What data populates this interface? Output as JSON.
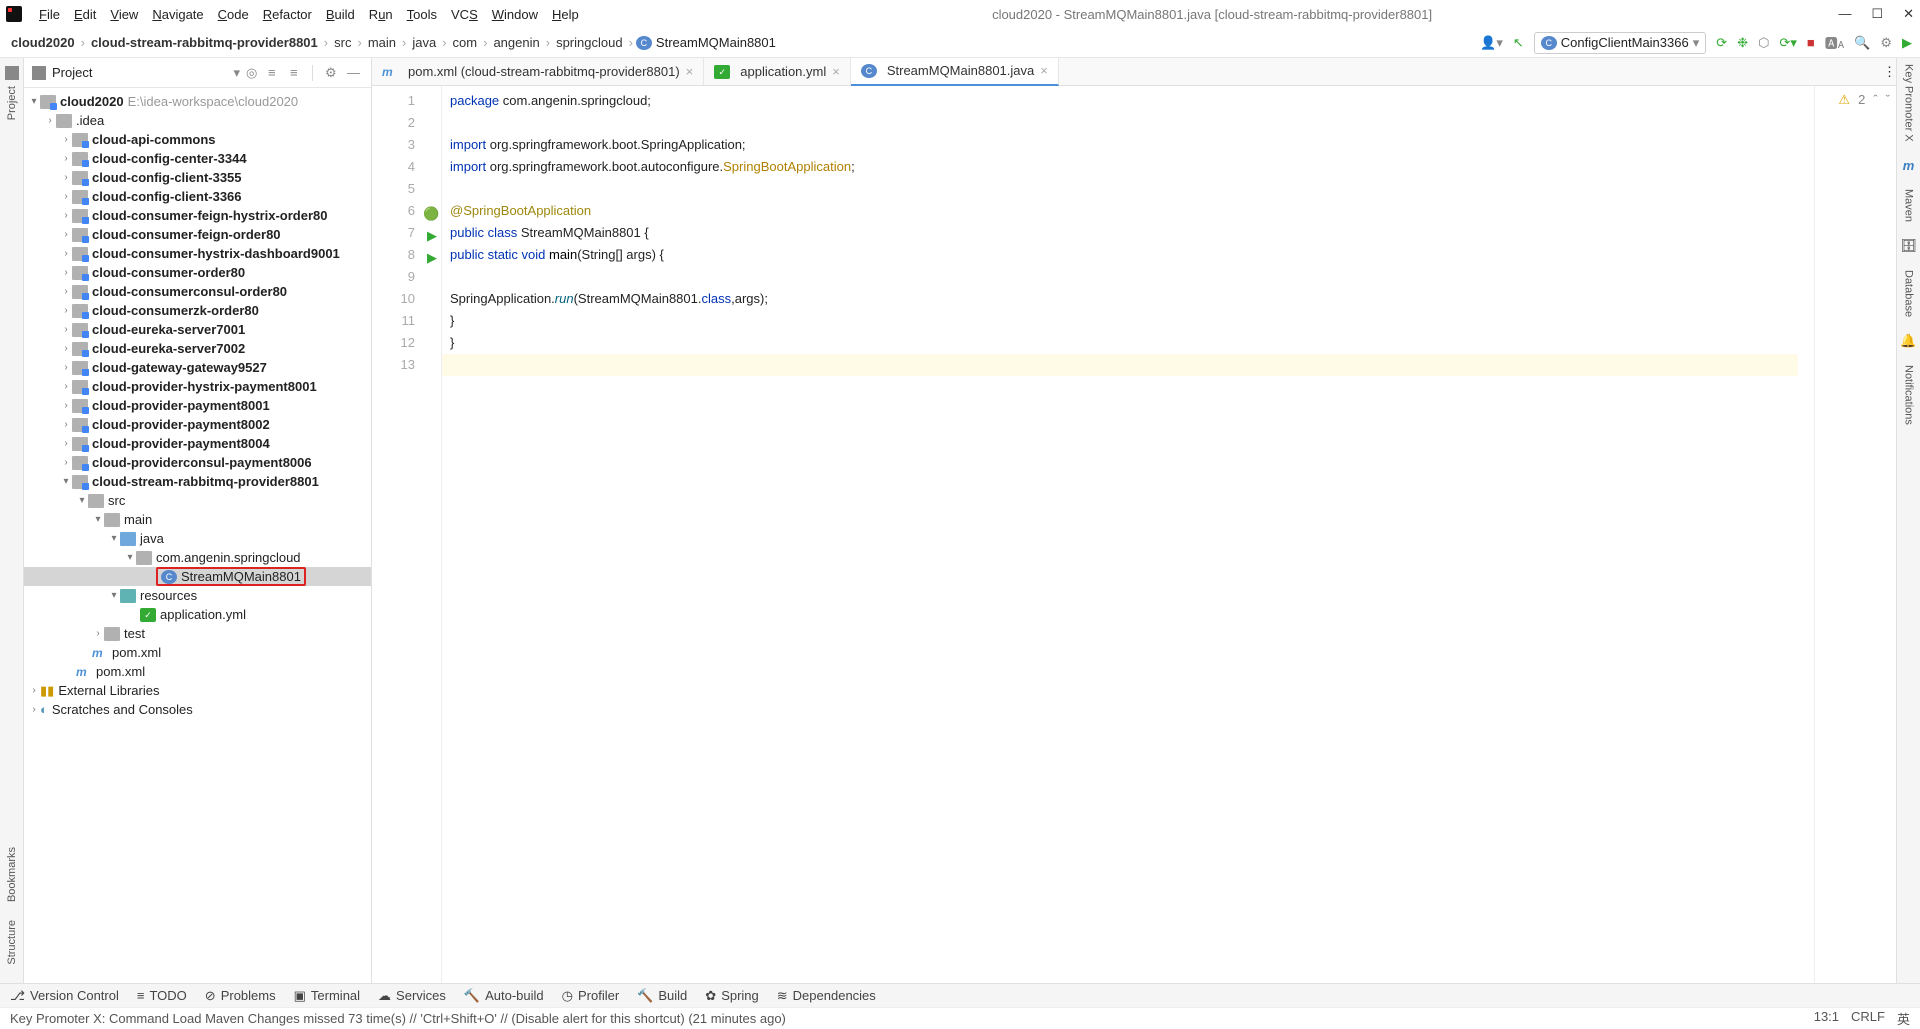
{
  "menu": [
    "File",
    "Edit",
    "View",
    "Navigate",
    "Code",
    "Refactor",
    "Build",
    "Run",
    "Tools",
    "VCS",
    "Window",
    "Help"
  ],
  "window_title": "cloud2020 - StreamMQMain8801.java [cloud-stream-rabbitmq-provider8801]",
  "breadcrumbs": [
    "cloud2020",
    "cloud-stream-rabbitmq-provider8801",
    "src",
    "main",
    "java",
    "com",
    "angenin",
    "springcloud"
  ],
  "breadcrumb_last": "StreamMQMain8801",
  "run_config": "ConfigClientMain3366",
  "panel_title": "Project",
  "root_name": "cloud2020",
  "root_path": "E:\\idea-workspace\\cloud2020",
  "tree": {
    "idea": ".idea",
    "modules": [
      "cloud-api-commons",
      "cloud-config-center-3344",
      "cloud-config-client-3355",
      "cloud-config-client-3366",
      "cloud-consumer-feign-hystrix-order80",
      "cloud-consumer-feign-order80",
      "cloud-consumer-hystrix-dashboard9001",
      "cloud-consumer-order80",
      "cloud-consumerconsul-order80",
      "cloud-consumerzk-order80",
      "cloud-eureka-server7001",
      "cloud-eureka-server7002",
      "cloud-gateway-gateway9527",
      "cloud-provider-hystrix-payment8001",
      "cloud-provider-payment8001",
      "cloud-provider-payment8002",
      "cloud-provider-payment8004",
      "cloud-providerconsul-payment8006",
      "cloud-stream-rabbitmq-provider8801"
    ],
    "src": "src",
    "main": "main",
    "java": "java",
    "pkg": "com.angenin.springcloud",
    "cls": "StreamMQMain8801",
    "resources": "resources",
    "yml": "application.yml",
    "test": "test",
    "pom": "pom.xml",
    "ext": "External Libraries",
    "scratches": "Scratches and Consoles"
  },
  "tabs": {
    "t1": "pom.xml (cloud-stream-rabbitmq-provider8801)",
    "t2": "application.yml",
    "t3": "StreamMQMain8801.java"
  },
  "code": {
    "l1a": "package",
    "l1b": " com.angenin.springcloud;",
    "l3a": "import",
    "l3b": " org.springframework.boot.SpringApplication;",
    "l4a": "import",
    "l4b": " org.springframework.boot.autoconfigure.",
    "l4c": "SpringBootApplication",
    "l4d": ";",
    "l6": "@SpringBootApplication",
    "l7a": "public class",
    "l7b": " StreamMQMain8801 {",
    "l8a": "    public static void",
    "l8b": " main",
    "l8c": "(String[] args) {",
    "l10a": "        SpringApplication.",
    "l10b": "run",
    "l10c": "(StreamMQMain8801.",
    "l10d": "class",
    "l10e": ",args);",
    "l11": "    }",
    "l12": "}"
  },
  "warnings": "2",
  "bottom": [
    "Version Control",
    "TODO",
    "Problems",
    "Terminal",
    "Services",
    "Auto-build",
    "Profiler",
    "Build",
    "Spring",
    "Dependencies"
  ],
  "status_text": "Key Promoter X: Command Load Maven Changes missed 73 time(s) // 'Ctrl+Shift+O' // (Disable alert for this shortcut) (21 minutes ago)",
  "status_right": {
    "pos": "13:1",
    "enc": "CRLF",
    "lang": "英"
  },
  "left_stripe": [
    "Project",
    "Bookmarks",
    "Structure"
  ],
  "right_stripe": [
    "Key Promoter X",
    "Maven",
    "Database",
    "Notifications"
  ]
}
